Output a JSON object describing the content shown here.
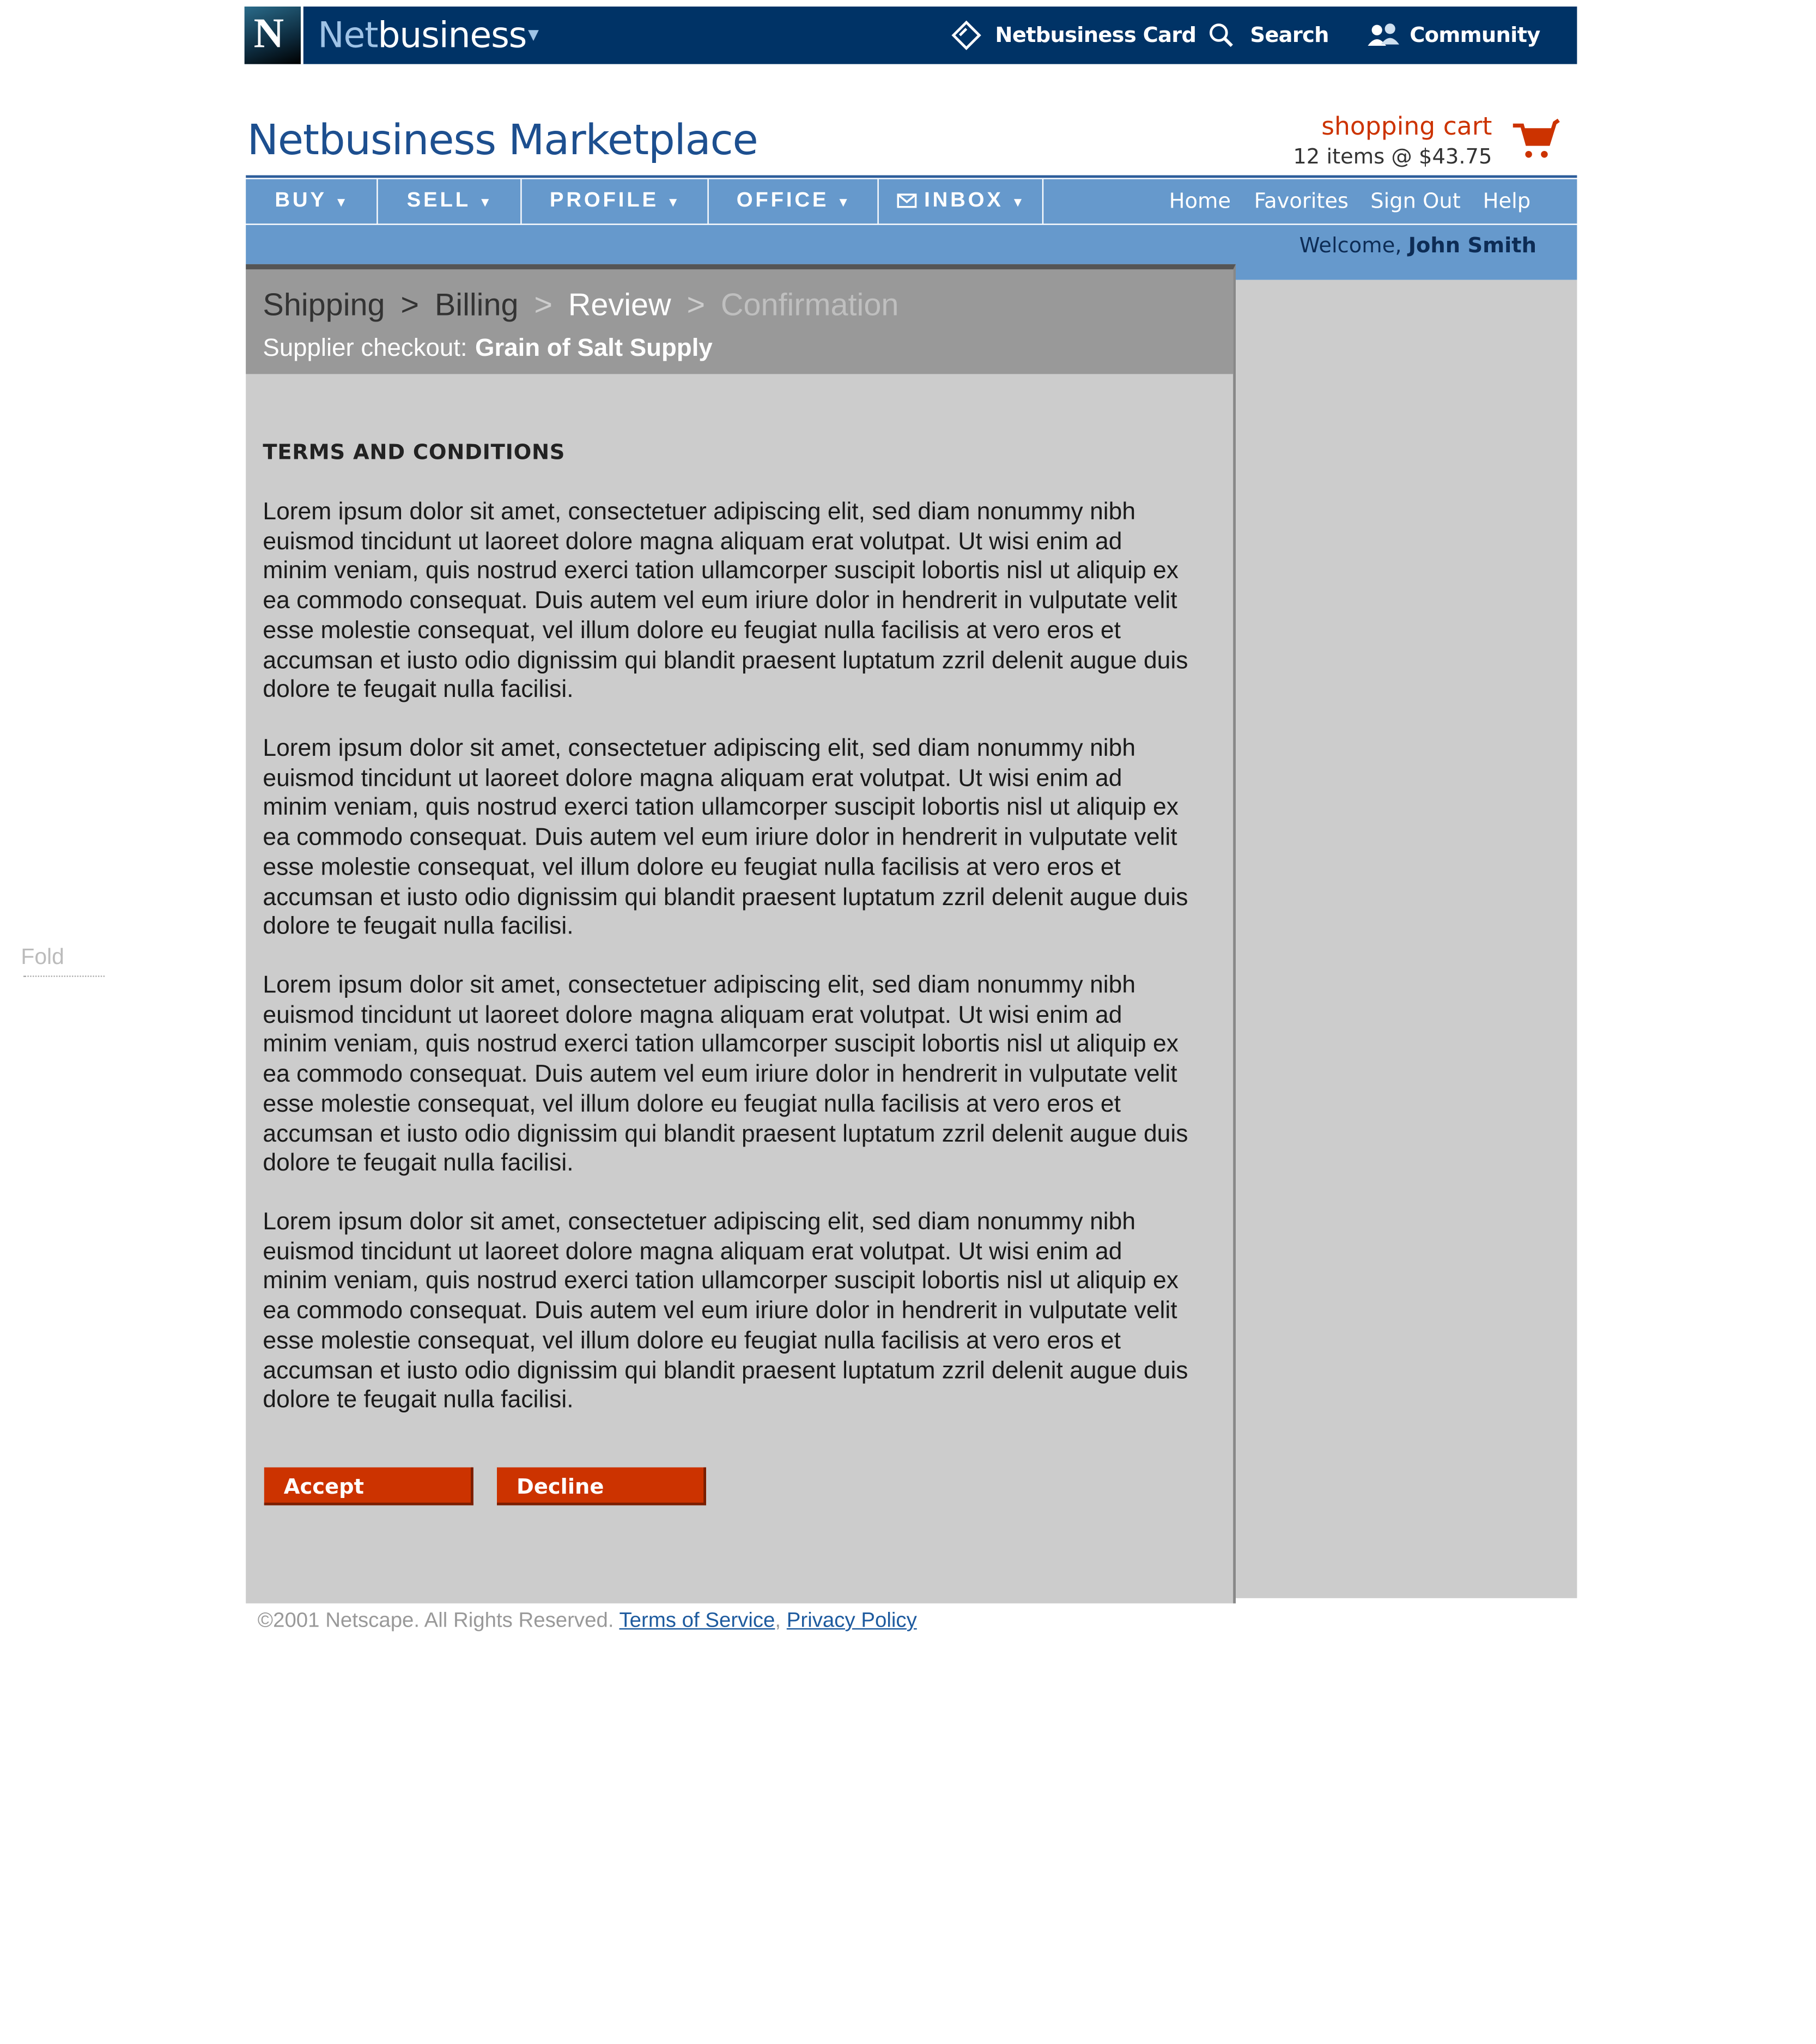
{
  "topbar": {
    "logo_letter": "N",
    "brand_light": "Net",
    "brand_bold": "business",
    "links": [
      {
        "label": "Netbusiness Card",
        "icon": "card-icon"
      },
      {
        "label": "Search",
        "icon": "search-icon"
      },
      {
        "label": "Community",
        "icon": "community-icon"
      }
    ]
  },
  "header": {
    "title": "Netbusiness Marketplace",
    "cart_label": "shopping cart",
    "cart_items": "12 items @ $43.75"
  },
  "nav": {
    "tabs": [
      "BUY",
      "SELL",
      "PROFILE",
      "OFFICE",
      "INBOX"
    ],
    "links": [
      "Home",
      "Favorites",
      "Sign Out",
      "Help"
    ],
    "welcome_prefix": "Welcome,",
    "user_name": "John Smith"
  },
  "checkout": {
    "steps": [
      "Shipping",
      "Billing",
      "Review",
      "Confirmation"
    ],
    "separator": ">",
    "supplier_prefix": "Supplier checkout:",
    "supplier_name": "Grain of Salt Supply"
  },
  "terms": {
    "heading": "TERMS AND CONDITIONS",
    "paragraphs": [
      "Lorem ipsum dolor sit amet, consectetuer adipiscing elit, sed diam nonummy nibh euismod tincidunt ut laoreet dolore magna aliquam erat volutpat. Ut wisi enim ad minim veniam, quis nostrud exerci tation ullamcorper suscipit lobortis nisl ut aliquip ex ea commodo consequat. Duis autem vel eum iriure dolor in hendrerit in vulputate velit esse molestie consequat, vel illum dolore eu feugiat nulla facilisis at vero eros et accumsan et iusto odio dignissim qui blandit praesent luptatum zzril delenit augue duis dolore te feugait nulla facilisi.",
      "Lorem ipsum dolor sit amet, consectetuer adipiscing elit, sed diam nonummy nibh euismod tincidunt ut laoreet dolore magna aliquam erat volutpat. Ut wisi enim ad minim veniam, quis nostrud exerci tation ullamcorper suscipit lobortis nisl ut aliquip ex ea commodo consequat. Duis autem vel eum iriure dolor in hendrerit in vulputate velit esse molestie consequat, vel illum dolore eu feugiat nulla facilisis at vero eros et accumsan et iusto odio dignissim qui blandit praesent luptatum zzril delenit augue duis dolore te feugait nulla facilisi.",
      "Lorem ipsum dolor sit amet, consectetuer adipiscing elit, sed diam nonummy nibh euismod tincidunt ut laoreet dolore magna aliquam erat volutpat. Ut wisi enim ad minim veniam, quis nostrud exerci tation ullamcorper suscipit lobortis nisl ut aliquip ex ea commodo consequat. Duis autem vel eum iriure dolor in hendrerit in vulputate velit esse molestie consequat, vel illum dolore eu feugiat nulla facilisis at vero eros et accumsan et iusto odio dignissim qui blandit praesent luptatum zzril delenit augue duis dolore te feugait nulla facilisi.",
      "Lorem ipsum dolor sit amet, consectetuer adipiscing elit, sed diam nonummy nibh euismod tincidunt ut laoreet dolore magna aliquam erat volutpat. Ut wisi enim ad minim veniam, quis nostrud exerci tation ullamcorper suscipit lobortis nisl ut aliquip ex ea commodo consequat. Duis autem vel eum iriure dolor in hendrerit in vulputate velit esse molestie consequat, vel illum dolore eu feugiat nulla facilisis at vero eros et accumsan et iusto odio dignissim qui blandit praesent luptatum zzril delenit augue duis dolore te feugait nulla facilisi."
    ],
    "accept_label": "Accept",
    "decline_label": "Decline"
  },
  "footer": {
    "copyright": "©2001 Netscape. All Rights Reserved.",
    "terms_link": "Terms of Service",
    "comma": ",",
    "privacy_link": "Privacy Policy"
  },
  "fold_label": "Fold",
  "colors": {
    "topbar": "#003366",
    "nav": "#6699cc",
    "accent": "#cc3300",
    "panel": "#cccccc",
    "crumb_band": "#999999"
  }
}
